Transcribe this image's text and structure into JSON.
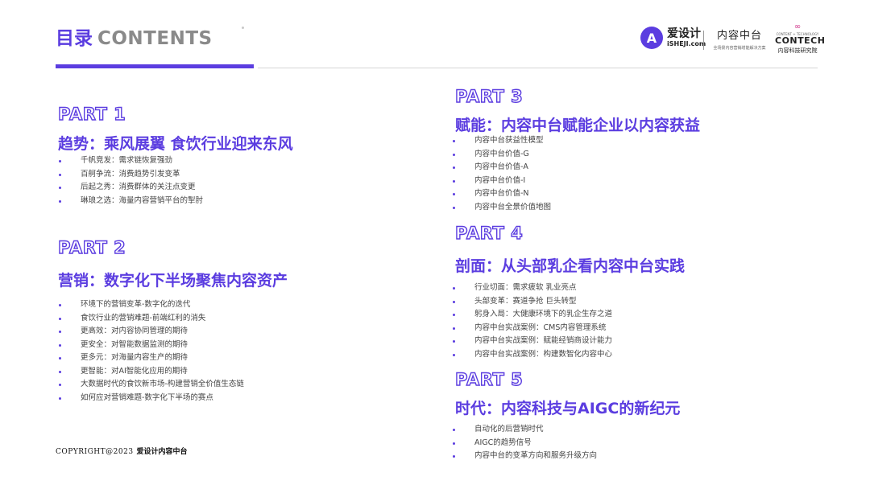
{
  "header": {
    "title_cn": "目录",
    "title_en": "CONTENTS"
  },
  "logos": {
    "aisheji": {
      "badge": "A",
      "cn": "爱设计",
      "en": "iSHEJI.com"
    },
    "neirong": {
      "cn": "内容中台",
      "sub": "全场景内容营销增能解决方案"
    },
    "contech": {
      "mark": "∞",
      "tag": "CONTENT + TECHNOLOGY",
      "en": "CONTECH",
      "cn": "内容科技研究院"
    }
  },
  "sections": [
    {
      "part": "PART 1",
      "title": "趋势：乘风展翼 食饮行业迎来东风",
      "items": [
        "千帆竞发：需求链恢复强劲",
        "百舸争流：消费趋势引发变革",
        "后起之秀：消费群体的关注点变更",
        "琳琅之选：海量内容营销平台的掣肘"
      ]
    },
    {
      "part": "PART 2",
      "title": "营销：数字化下半场聚焦内容资产",
      "items": [
        "环境下的营销变革-数字化的迭代",
        "食饮行业的营销难题-前端红利的消失",
        "更高效：对内容协同管理的期待",
        "更安全：对智能数据监测的期待",
        "更多元：对海量内容生产的期待",
        "更智能：对AI智能化应用的期待",
        "大数据时代的食饮新市场-构建营销全价值生态链",
        "如何应对营销难题-数字化下半场的赛点"
      ]
    },
    {
      "part": "PART 3",
      "title": "赋能：内容中台赋能企业以内容获益",
      "items": [
        "内容中台获益性模型",
        "内容中台价值-G",
        "内容中台价值-A",
        "内容中台价值-I",
        "内容中台价值-N",
        "内容中台全景价值地图"
      ]
    },
    {
      "part": "PART 4",
      "title": "剖面：从头部乳企看内容中台实践",
      "items": [
        "行业切面：需求疲软 乳业亮点",
        "头部变革：赛道争抢 巨头转型",
        "躬身入局：大健康环境下的乳企生存之道",
        "内容中台实战案例：CMS内容管理系统",
        "内容中台实战案例：赋能经销商设计能力",
        "内容中台实战案例：构建数智化内容中心"
      ]
    },
    {
      "part": "PART 5",
      "title": "时代：内容科技与AIGC的新纪元",
      "items": [
        "自动化的后营销时代",
        "AIGC的趋势信号",
        "内容中台的变革方向和服务升级方向"
      ]
    }
  ],
  "footer": {
    "copyright_en": "COPYRIGHT@2023",
    "copyright_cn": "爱设计内容中台"
  }
}
